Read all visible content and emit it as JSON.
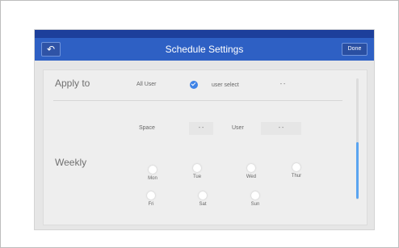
{
  "header": {
    "title": "Schedule Settings",
    "back_icon": "back-arrow-icon",
    "done_label": "Done"
  },
  "apply_to": {
    "label": "Apply to",
    "all_user_label": "All User",
    "all_user_checked": true,
    "user_select_label": "user select",
    "user_select_value": "- -",
    "space_label": "Space",
    "space_value": "- -",
    "user_label": "User",
    "user_value": "- -"
  },
  "weekly": {
    "label": "Weekly",
    "days": [
      "Mon",
      "Tue",
      "Wed",
      "Thur",
      "Fri",
      "Sat",
      "Sun"
    ]
  },
  "colors": {
    "header": "#2e60c4",
    "top_strip": "#1d3f9b",
    "accent": "#3f83e6"
  }
}
